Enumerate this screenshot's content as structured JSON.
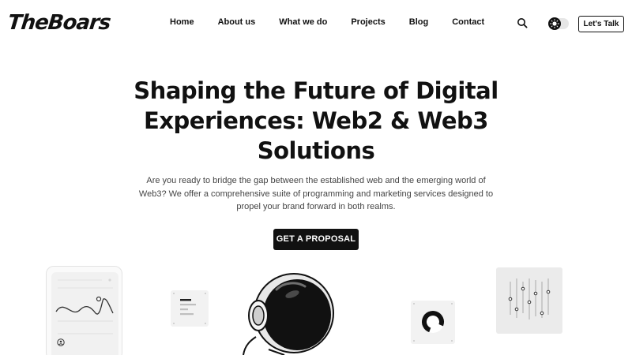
{
  "logo": {
    "text": "TheBoars"
  },
  "nav": {
    "items": [
      {
        "label": "Home"
      },
      {
        "label": "About us"
      },
      {
        "label": "What we do"
      },
      {
        "label": "Projects"
      },
      {
        "label": "Blog"
      },
      {
        "label": "Contact"
      }
    ]
  },
  "header": {
    "search_icon": "search-icon",
    "theme_icon": "sun-icon",
    "cta_label": "Let's Talk"
  },
  "hero": {
    "title": "Shaping the Future of Digital Experiences: Web2 & Web3 Solutions",
    "description": "Are you ready to bridge the gap between the established web and the emerging world of Web3? We offer a comprehensive suite of programming and marketing services designed to propel your brand forward in both realms.",
    "cta_label": "GET A PROPOSAL"
  },
  "colors": {
    "accent": "#111111",
    "background": "#ffffff",
    "text_muted": "#444444"
  }
}
